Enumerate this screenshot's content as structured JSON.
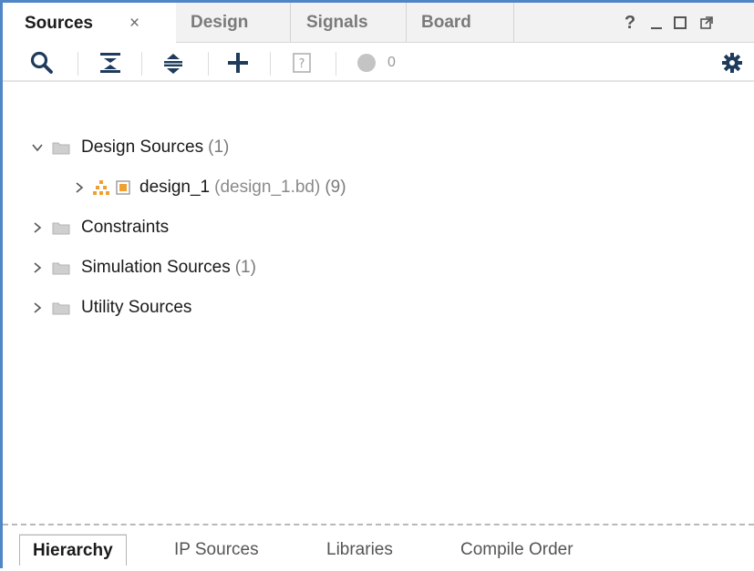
{
  "tabs": [
    {
      "label": "Sources",
      "active": true
    },
    {
      "label": "Design",
      "active": false
    },
    {
      "label": "Signals",
      "active": false
    },
    {
      "label": "Board",
      "active": false
    }
  ],
  "tab_close_glyph": "×",
  "window_controls": {
    "help": "?",
    "minimize": "_",
    "maximize": "☐",
    "float": "⧉"
  },
  "toolbar": {
    "icons": [
      "search-icon",
      "collapse-all-icon",
      "expand-all-icon",
      "add-icon",
      "unknown-file-icon",
      "status-dot-icon",
      "gear-icon"
    ],
    "status_count": "0"
  },
  "tree": {
    "design_sources": {
      "label": "Design Sources",
      "count": "(1)"
    },
    "design_1": {
      "name": "design_1",
      "file": "(design_1.bd)",
      "count": "(9)"
    },
    "constraints": {
      "label": "Constraints"
    },
    "simulation_sources": {
      "label": "Simulation Sources",
      "count": "(1)"
    },
    "utility_sources": {
      "label": "Utility Sources"
    }
  },
  "bottom_tabs": [
    {
      "label": "Hierarchy",
      "active": true
    },
    {
      "label": "IP Sources",
      "active": false
    },
    {
      "label": "Libraries",
      "active": false
    },
    {
      "label": "Compile Order",
      "active": false
    }
  ],
  "colors": {
    "accent_border": "#4f86c6",
    "icon_dark": "#1f3b5c",
    "folder": "#c9c9c9",
    "bd_orange": "#f0a030"
  }
}
